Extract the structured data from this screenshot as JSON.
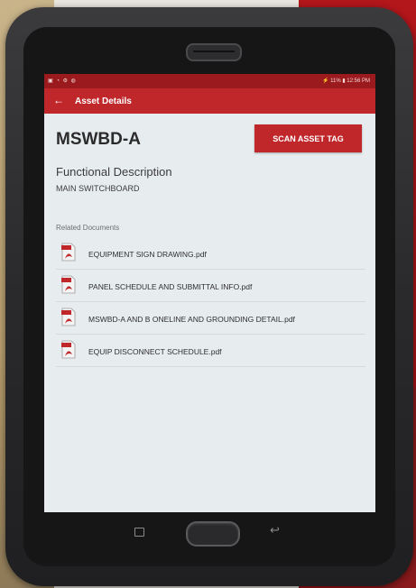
{
  "status_bar": {
    "left_icons": "▣ ◔ ⚙ ◍",
    "right_text": "⚡ 11% ▮ 12:56 PM"
  },
  "app_bar": {
    "back_icon": "←",
    "title": "Asset Details"
  },
  "asset": {
    "name": "MSWBD-A",
    "scan_button_label": "SCAN ASSET TAG",
    "description_label": "Functional Description",
    "description_value": "MAIN SWITCHBOARD"
  },
  "documents": {
    "section_label": "Related Documents",
    "items": [
      {
        "name": "EQUIPMENT SIGN DRAWING.pdf",
        "icon": "pdf-icon"
      },
      {
        "name": "PANEL SCHEDULE AND SUBMITTAL INFO.pdf",
        "icon": "pdf-icon"
      },
      {
        "name": "MSWBD-A AND B ONELINE AND GROUNDING DETAIL.pdf",
        "icon": "pdf-icon"
      },
      {
        "name": "EQUIP DISCONNECT SCHEDULE.pdf",
        "icon": "pdf-icon"
      }
    ]
  },
  "nav_bar": {
    "back_glyph": "↩"
  },
  "colors": {
    "accent": "#c0272b",
    "status_bar": "#9a1a1d",
    "screen_bg": "#e7ecef"
  }
}
